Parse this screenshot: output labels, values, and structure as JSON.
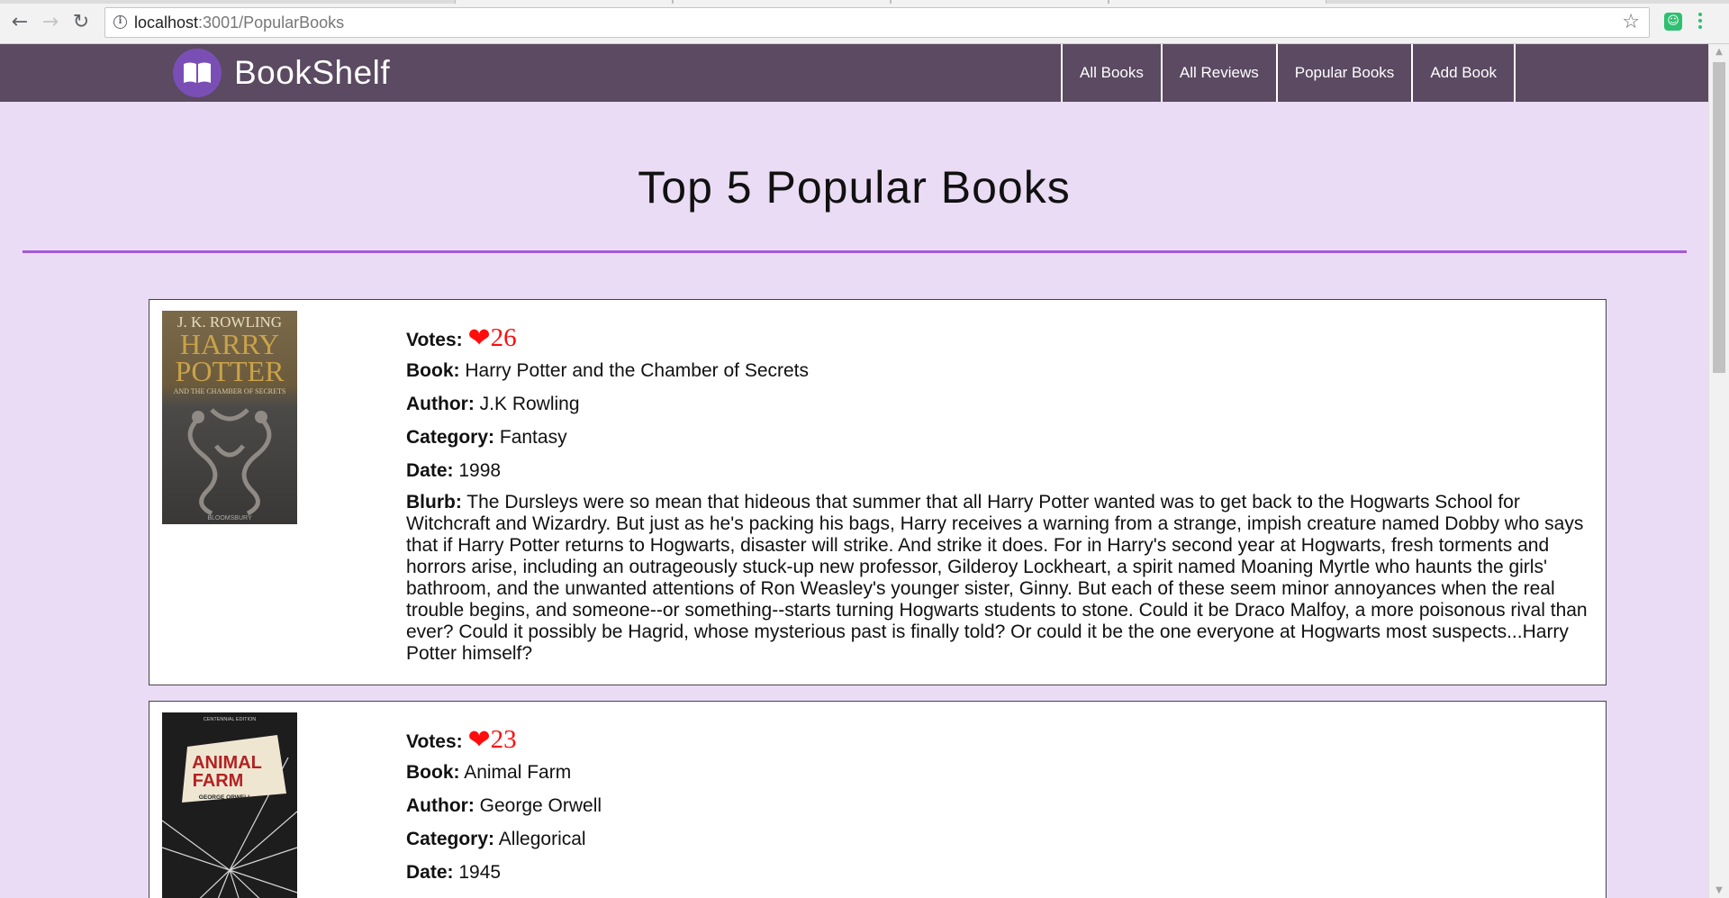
{
  "browser": {
    "url_host": "localhost",
    "url_path": ":3001/PopularBooks"
  },
  "navbar": {
    "brand": "BookShelf",
    "links": [
      "All Books",
      "All Reviews",
      "Popular Books",
      "Add Book"
    ]
  },
  "page": {
    "title": "Top 5 Popular Books",
    "labels": {
      "votes": "Votes:",
      "book": "Book:",
      "author": "Author:",
      "category": "Category:",
      "date": "Date:",
      "blurb": "Blurb:"
    }
  },
  "books": [
    {
      "votes": "26",
      "title": "Harry Potter and the Chamber of Secrets",
      "author": "J.K Rowling",
      "category": "Fantasy",
      "date": "1998",
      "blurb": "The Dursleys were so mean that hideous that summer that all Harry Potter wanted was to get back to the Hogwarts School for Witchcraft and Wizardry. But just as he's packing his bags, Harry receives a warning from a strange, impish creature named Dobby who says that if Harry Potter returns to Hogwarts, disaster will strike. And strike it does. For in Harry's second year at Hogwarts, fresh torments and horrors arise, including an outrageously stuck-up new professor, Gilderoy Lockheart, a spirit named Moaning Myrtle who haunts the girls' bathroom, and the unwanted attentions of Ron Weasley's younger sister, Ginny. But each of these seem minor annoyances when the real trouble begins, and someone--or something--starts turning Hogwarts students to stone. Could it be Draco Malfoy, a more poisonous rival than ever? Could it possibly be Hagrid, whose mysterious past is finally told? Or could it be the one everyone at Hogwarts most suspects...Harry Potter himself?",
      "cover": {
        "author_line": "J. K. ROWLING",
        "title_line1": "HARRY",
        "title_line2": "POTTER",
        "subtitle": "AND THE CHAMBER OF SECRETS",
        "publisher": "BLOOMSBURY"
      }
    },
    {
      "votes": "23",
      "title": "Animal Farm",
      "author": "George Orwell",
      "category": "Allegorical",
      "date": "1945",
      "cover": {
        "edition": "CENTENNIAL EDITION",
        "title_line1": "ANIMAL",
        "title_line2": "FARM",
        "author_line": "GEORGE ORWELL"
      }
    }
  ],
  "colors": {
    "navbar": "#5b4a61",
    "page_bg": "#ebdcf5",
    "accent_rule": "#a259d9",
    "heart": "#ff0d0d",
    "logo_bg": "#7a4fb5"
  }
}
